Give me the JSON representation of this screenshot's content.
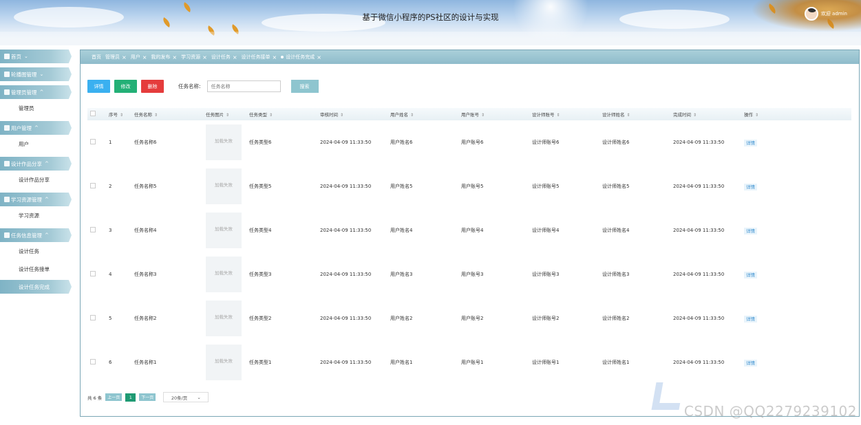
{
  "header": {
    "title": "基于微信小程序的PS社区的设计与实现",
    "welcome": "欢迎 admin"
  },
  "sidebar": {
    "menus": [
      {
        "label": "首页",
        "icon": "home-icon",
        "children": []
      },
      {
        "label": "轮播图管理",
        "icon": "carousel-icon",
        "children": []
      },
      {
        "label": "管理员管理",
        "icon": "admin-icon",
        "children": [
          "管理员"
        ]
      },
      {
        "label": "用户管理",
        "icon": "user-icon",
        "children": [
          "用户"
        ]
      },
      {
        "label": "设计作品分享",
        "icon": "grid-icon",
        "children": [
          "设计作品分享"
        ]
      },
      {
        "label": "学习资源管理",
        "icon": "book-icon",
        "children": [
          "学习资源"
        ]
      },
      {
        "label": "任务信息管理",
        "icon": "task-icon",
        "children": [
          "设计任务",
          "设计任务接单",
          "设计任务完成"
        ]
      }
    ],
    "active_item": "设计任务完成"
  },
  "tabs": [
    "首页",
    "管理员",
    "用户",
    "我的发布",
    "学习资源",
    "设计任务",
    "设计任务接单",
    "设计任务完成"
  ],
  "toolbar": {
    "detail_label": "详情",
    "edit_label": "修改",
    "delete_label": "删除",
    "search_label": "任务名称:",
    "search_placeholder": "任务名称",
    "search_button": "搜索"
  },
  "table": {
    "columns": [
      "序号",
      "任务名称",
      "任务图片",
      "任务类型",
      "审核时间",
      "用户姓名",
      "用户账号",
      "设计师账号",
      "设计师姓名",
      "完成时间",
      "操作"
    ],
    "image_fail_text": "加载失败",
    "action_label": "详情",
    "rows": [
      {
        "no": "1",
        "name": "任务名称6",
        "type": "任务类型6",
        "review_time": "2024-04-09 11:33:50",
        "user_name": "用户姓名6",
        "user_account": "用户账号6",
        "designer_account": "设计师账号6",
        "designer_name": "设计师姓名6",
        "finish_time": "2024-04-09 11:33:50"
      },
      {
        "no": "2",
        "name": "任务名称5",
        "type": "任务类型5",
        "review_time": "2024-04-09 11:33:50",
        "user_name": "用户姓名5",
        "user_account": "用户账号5",
        "designer_account": "设计师账号5",
        "designer_name": "设计师姓名5",
        "finish_time": "2024-04-09 11:33:50"
      },
      {
        "no": "3",
        "name": "任务名称4",
        "type": "任务类型4",
        "review_time": "2024-04-09 11:33:50",
        "user_name": "用户姓名4",
        "user_account": "用户账号4",
        "designer_account": "设计师账号4",
        "designer_name": "设计师姓名4",
        "finish_time": "2024-04-09 11:33:50"
      },
      {
        "no": "4",
        "name": "任务名称3",
        "type": "任务类型3",
        "review_time": "2024-04-09 11:33:50",
        "user_name": "用户姓名3",
        "user_account": "用户账号3",
        "designer_account": "设计师账号3",
        "designer_name": "设计师姓名3",
        "finish_time": "2024-04-09 11:33:50"
      },
      {
        "no": "5",
        "name": "任务名称2",
        "type": "任务类型2",
        "review_time": "2024-04-09 11:33:50",
        "user_name": "用户姓名2",
        "user_account": "用户账号2",
        "designer_account": "设计师账号2",
        "designer_name": "设计师姓名2",
        "finish_time": "2024-04-09 11:33:50"
      },
      {
        "no": "6",
        "name": "任务名称1",
        "type": "任务类型1",
        "review_time": "2024-04-09 11:33:50",
        "user_name": "用户姓名1",
        "user_account": "用户账号1",
        "designer_account": "设计师账号1",
        "designer_name": "设计师姓名1",
        "finish_time": "2024-04-09 11:33:50"
      }
    ]
  },
  "pager": {
    "total": "共 6 条",
    "prev": "上一页",
    "current": "1",
    "next": "下一页",
    "page_size": "20条/页"
  },
  "watermark": "CSDN @QQ2279239102",
  "colors": {
    "accent": "#8ec5cf",
    "menu": "#7fb3c5",
    "blue_btn": "#3ab0f0",
    "green_btn": "#23b076",
    "red_btn": "#e53c3c"
  }
}
